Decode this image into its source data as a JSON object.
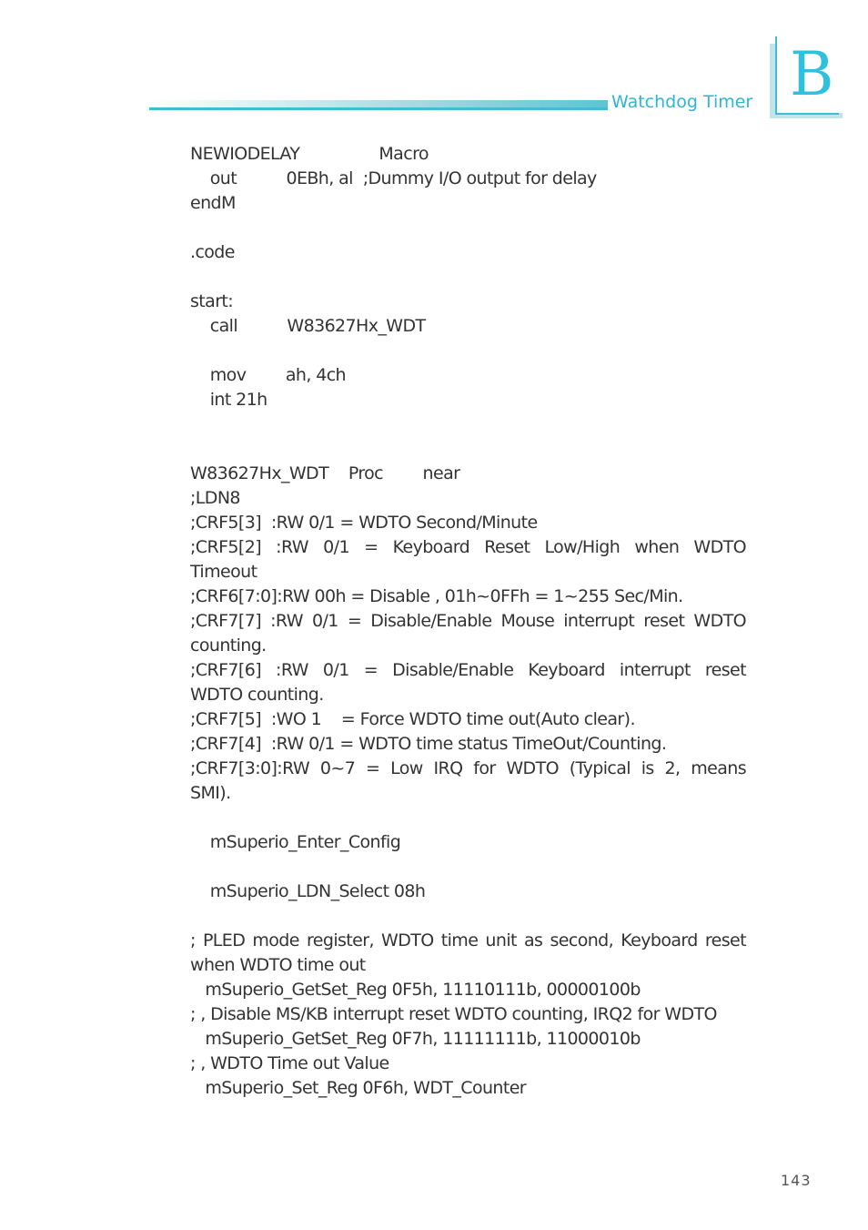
{
  "header": {
    "section_title": "Watchdog Timer",
    "chapter_letter": "B",
    "accent_color": "#2fb4d3"
  },
  "code_lines": [
    "NEWIODELAY                Macro",
    "    out          0EBh, al  ;Dummy I/O output for delay",
    "endM",
    "",
    ".code",
    "",
    "start:",
    "    call          W83627Hx_WDT",
    "",
    "    mov        ah, 4ch",
    "    int 21h",
    "",
    "",
    "W83627Hx_WDT    Proc        near",
    ";LDN8",
    ";CRF5[3]  :RW 0/1 = WDTO Second/Minute",
    ";CRF5[2]  :RW 0/1 = Keyboard Reset Low/High when WDTO",
    "Timeout",
    ";CRF6[7:0]:RW 00h = Disable , 01h~0FFh = 1~255 Sec/Min.",
    ";CRF7[7]  :RW 0/1 = Disable/Enable Mouse interrupt reset WDTO",
    "counting.",
    ";CRF7[6]  :RW 0/1 = Disable/Enable Keyboard interrupt reset",
    "WDTO counting.",
    ";CRF7[5]  :WO 1    = Force WDTO time out(Auto clear).",
    ";CRF7[4]  :RW 0/1 = WDTO time status TimeOut/Counting.",
    ";CRF7[3:0]:RW 0~7 = Low IRQ for WDTO (Typical is 2, means",
    "SMI).",
    "",
    "    mSuperio_Enter_Config",
    "",
    "    mSuperio_LDN_Select 08h",
    "",
    "; PLED mode register, WDTO time unit as second, Keyboard reset",
    "when WDTO time out",
    "   mSuperio_GetSet_Reg 0F5h, 11110111b, 00000100b",
    "; , Disable MS/KB interrupt reset WDTO counting, IRQ2 for WDTO",
    "   mSuperio_GetSet_Reg 0F7h, 11111111b, 11000010b",
    "; , WDTO Time out Value",
    "   mSuperio_Set_Reg 0F6h, WDT_Counter"
  ],
  "justified_lines": [
    16,
    19,
    21,
    25,
    32
  ],
  "footer": {
    "page_number": "143"
  }
}
